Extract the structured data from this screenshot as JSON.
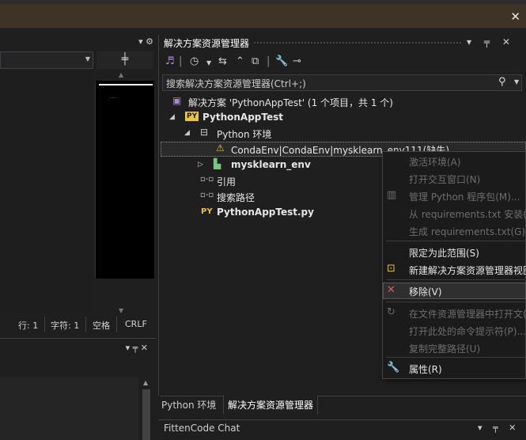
{
  "infobar": {
    "close_glyph": "✕"
  },
  "left_panel": {
    "header_icons": "▾ ⚙",
    "status": {
      "line": "行: 1",
      "char": "字符: 1",
      "spaces": "空格",
      "eol": "CRLF"
    },
    "lower_header_icons": "▾ ╤ ✕"
  },
  "solution_explorer": {
    "title": "解决方案资源管理器",
    "title_icons": "▾ ╤ ✕",
    "search_placeholder": "搜索解决方案资源管理器(Ctrl+;)",
    "tree": {
      "solution": "解决方案 'PythonAppTest' (1 个项目，共 1 个)",
      "project": "PythonAppTest",
      "python_env": "Python 环境",
      "conda_env": "CondaEnv|CondaEnv|mysklearn_env111(缺失)",
      "venv": "mysklearn_env",
      "references": "引用",
      "search_paths": "搜索路径",
      "file": "PythonAppTest.py",
      "py_badge": "PY"
    },
    "tabs": [
      "Python 环境",
      "解决方案资源管理器"
    ]
  },
  "fitten": {
    "title": "FittenCode Chat",
    "icons": "▾ ╤ ✕"
  },
  "context_menu": {
    "items": [
      {
        "label": "激活环境(A)",
        "enabled": false,
        "icon": ""
      },
      {
        "label": "打开交互窗口(N)",
        "enabled": false,
        "icon": ""
      },
      {
        "label": "管理 Python 程序包(M)...",
        "enabled": false,
        "icon": "package-icon"
      },
      {
        "label": "从 requirements.txt 安装(",
        "enabled": false,
        "icon": ""
      },
      {
        "label": "生成 requirements.txt(G)",
        "enabled": false,
        "icon": ""
      },
      {
        "label": "限定为此范围(S)",
        "enabled": true,
        "icon": ""
      },
      {
        "label": "新建解决方案资源管理器视图",
        "enabled": true,
        "icon": "new-view-icon"
      },
      {
        "label": "移除(V)",
        "enabled": true,
        "icon": "remove-icon"
      },
      {
        "label": "在文件资源管理器中打开文(",
        "enabled": false,
        "icon": "open-folder-icon"
      },
      {
        "label": "打开此处的命令提示符(P)...",
        "enabled": false,
        "icon": ""
      },
      {
        "label": "复制完整路径(U)",
        "enabled": false,
        "icon": ""
      },
      {
        "label": "属性(R)",
        "enabled": true,
        "icon": "wrench-icon"
      }
    ]
  },
  "colors": {
    "accent": "#0078d4",
    "warning": "#e8c34a",
    "remove": "#e05a5a",
    "infobar": "#3f3327"
  }
}
